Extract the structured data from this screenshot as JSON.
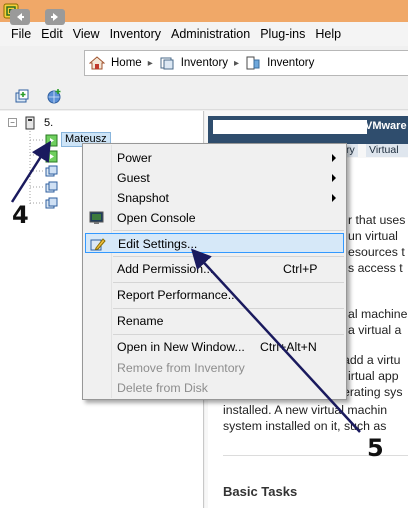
{
  "menubar": {
    "items": [
      "File",
      "Edit",
      "View",
      "Inventory",
      "Administration",
      "Plug-ins",
      "Help"
    ]
  },
  "breadcrumb": {
    "items": [
      {
        "label": "Home",
        "icon": "home-icon"
      },
      {
        "label": "Inventory",
        "icon": "inventory-icon"
      },
      {
        "label": "Inventory",
        "icon": "inventory-icon"
      }
    ]
  },
  "tree": {
    "root_label": "5.",
    "selected_vm": "Mateusz"
  },
  "right_panel": {
    "header_title": "VMware",
    "tabs": [
      "ry",
      "Virtual"
    ],
    "paragraphs": [
      [
        "r that uses",
        "un virtual",
        "esources t",
        "s access t"
      ],
      [
        "al machine",
        "a virtual a"
      ],
      [
        "add a virtu",
        "irtual app",
        "erating sys",
        "installed. A new virtual machin",
        "system installed on it, such as"
      ]
    ],
    "basic_tasks": "Basic Tasks"
  },
  "context_menu": {
    "items": [
      {
        "label": "Power",
        "submenu": true
      },
      {
        "label": "Guest",
        "submenu": true
      },
      {
        "label": "Snapshot",
        "submenu": true
      },
      {
        "label": "Open Console",
        "icon": "console-icon"
      },
      {
        "label": "Edit Settings...",
        "icon": "edit-settings-icon",
        "highlighted": true
      },
      {
        "label": "Add Permission...",
        "shortcut": "Ctrl+P"
      },
      {
        "label": "Report Performance..."
      },
      {
        "label": "Rename"
      },
      {
        "label": "Open in New Window...",
        "shortcut": "Ctrl+Alt+N"
      },
      {
        "label": "Remove from Inventory",
        "disabled": true
      },
      {
        "label": "Delete from Disk",
        "disabled": true
      }
    ]
  },
  "annotations": {
    "step_a": "4",
    "step_b": "5"
  },
  "colors": {
    "accent_highlight": "#3399ff",
    "vm_green": "#3cb034",
    "header_navy": "#2f4d6d",
    "titlebar": "#f0a868"
  }
}
